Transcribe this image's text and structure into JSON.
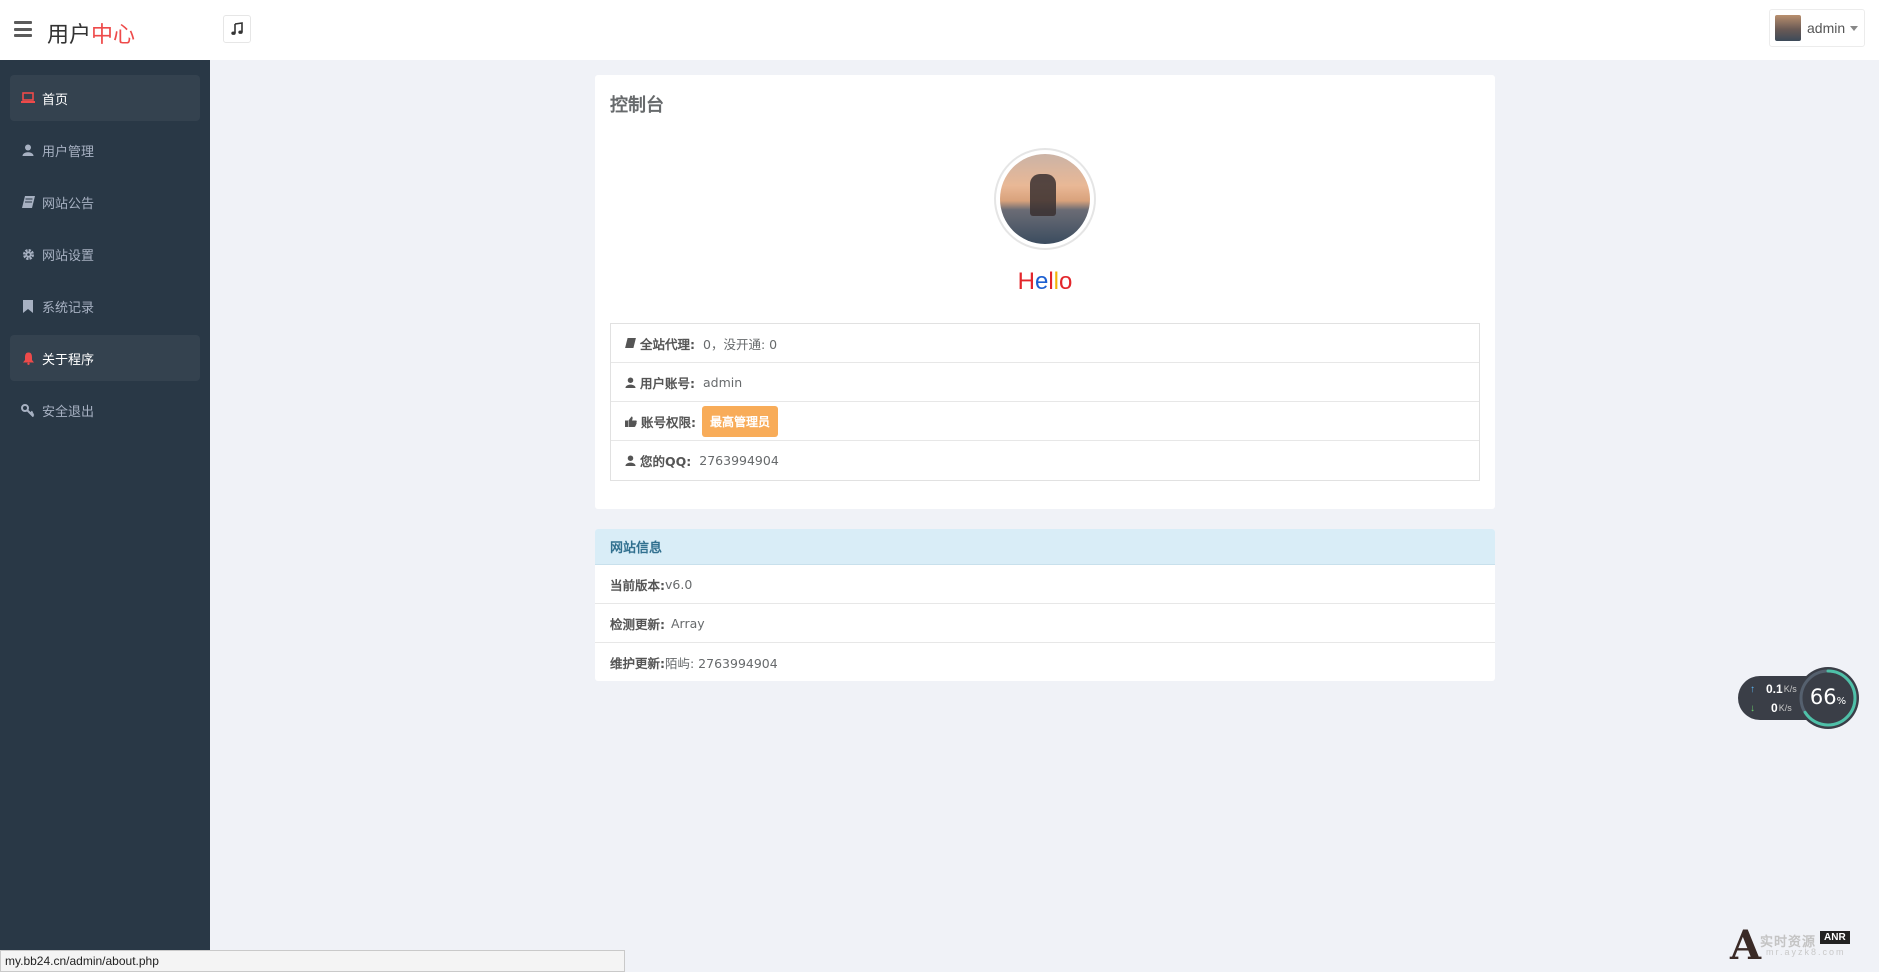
{
  "header": {
    "brand_part1": "用户",
    "brand_part2": "中心",
    "username": "admin"
  },
  "sidebar": {
    "items": [
      {
        "label": "首页",
        "icon": "laptop-icon",
        "active": true
      },
      {
        "label": "用户管理",
        "icon": "user-icon",
        "active": false
      },
      {
        "label": "网站公告",
        "icon": "book-icon",
        "active": false
      },
      {
        "label": "网站设置",
        "icon": "gear-icon",
        "active": false
      },
      {
        "label": "系统记录",
        "icon": "bookmark-icon",
        "active": false
      },
      {
        "label": "关于程序",
        "icon": "bell-icon",
        "active": false
      },
      {
        "label": "安全退出",
        "icon": "key-icon",
        "active": false
      }
    ]
  },
  "dashboard": {
    "title": "控制台",
    "hello_letters": [
      "H",
      "e",
      "l",
      "l",
      "o"
    ],
    "hello_colors": [
      "#e3262b",
      "#1c5fd1",
      "#e3262b",
      "#f2b306",
      "#e3262b"
    ],
    "info": {
      "agents_label": "全站代理:",
      "agents_value": "0，没开通: 0",
      "account_label": "用户账号:",
      "account_value": "admin",
      "role_label": "账号权限:",
      "role_value": "最高管理员",
      "qq_label": "您的QQ:",
      "qq_value": "2763994904"
    }
  },
  "site_info": {
    "title": "网站信息",
    "rows": [
      {
        "label": "当前版本:",
        "value": "v6.0"
      },
      {
        "label": "检测更新:",
        "value": " Array"
      },
      {
        "label": "维护更新:",
        "value": "陌屿: 2763994904"
      }
    ]
  },
  "network_widget": {
    "upload_value": "0.1",
    "upload_unit": "K/s",
    "download_value": "0",
    "download_unit": "K/s",
    "percent": "66",
    "percent_symbol": "%",
    "percent_fraction": 0.66
  },
  "status_bar": {
    "url": "my.bb24.cn/admin/about.php"
  },
  "watermark": {
    "letter": "A",
    "text": "实时资源",
    "badge": "ANR",
    "url": "mr.ayzk8.com"
  },
  "colors": {
    "sidebar_bg": "#293846",
    "brand_accent": "#ee4a4a",
    "badge_orange": "#f8ac59",
    "panel_head": "#d9edf7",
    "page_bg": "#f0f2f7"
  }
}
